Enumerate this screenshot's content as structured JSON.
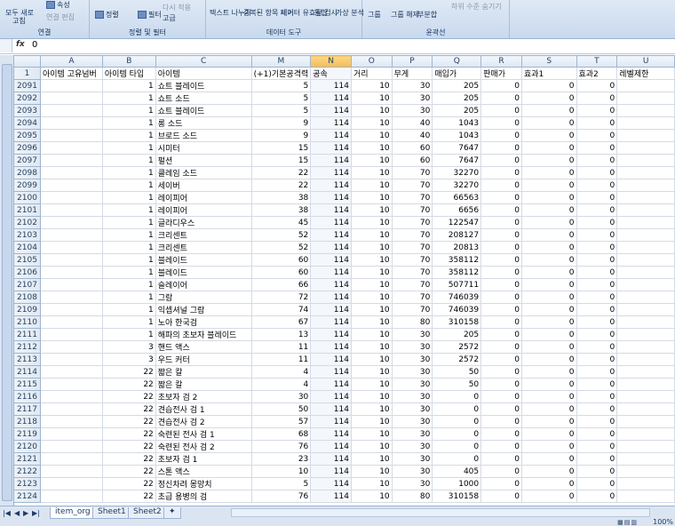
{
  "ribbon": {
    "groups": [
      {
        "title": "연결",
        "buttons": [
          "속성",
          "모두 새로",
          "고침",
          "연결 편집"
        ]
      },
      {
        "title": "정렬 및 필터",
        "buttons": [
          "정렬",
          "필터",
          "다시 적용",
          "고급"
        ]
      },
      {
        "title": "데이터 도구",
        "buttons": [
          "텍스트 나누기",
          "중복된 항목 제거",
          "데이터 유효성 검사",
          "통합",
          "가상 분석"
        ]
      },
      {
        "title": "윤곽선",
        "buttons": [
          "그룹",
          "그룹 해제",
          "부분합",
          "하위 수준 숨기기"
        ]
      }
    ]
  },
  "formula_bar": {
    "fx": "fx",
    "value": "0"
  },
  "columns": [
    {
      "id": "row",
      "label": ""
    },
    {
      "id": "A",
      "label": "A"
    },
    {
      "id": "B",
      "label": "B"
    },
    {
      "id": "C",
      "label": "C"
    },
    {
      "id": "M",
      "label": "M"
    },
    {
      "id": "N",
      "label": "N"
    },
    {
      "id": "O",
      "label": "O"
    },
    {
      "id": "P",
      "label": "P"
    },
    {
      "id": "Q",
      "label": "Q"
    },
    {
      "id": "R",
      "label": "R"
    },
    {
      "id": "S",
      "label": "S"
    },
    {
      "id": "T",
      "label": "T"
    },
    {
      "id": "U",
      "label": "U"
    }
  ],
  "header_row": [
    "1",
    "아이템 고유넘버",
    "아이템 타입",
    "아이템",
    "(+1)기본공격력",
    "공속",
    "거리",
    "무게",
    "매입가",
    "판매가",
    "효과1",
    "효과2",
    "레벨제한"
  ],
  "rows": [
    [
      "2091",
      "",
      "1",
      "쇼트 블레이드",
      "5",
      "114",
      "10",
      "30",
      "205",
      "0",
      "0",
      "0",
      ""
    ],
    [
      "2092",
      "",
      "1",
      "쇼트 소드",
      "5",
      "114",
      "10",
      "30",
      "205",
      "0",
      "0",
      "0",
      ""
    ],
    [
      "2093",
      "",
      "1",
      "쇼트 블레이드",
      "5",
      "114",
      "10",
      "30",
      "205",
      "0",
      "0",
      "0",
      ""
    ],
    [
      "2094",
      "",
      "1",
      "롱 소드",
      "9",
      "114",
      "10",
      "40",
      "1043",
      "0",
      "0",
      "0",
      ""
    ],
    [
      "2095",
      "",
      "1",
      "브로드 소드",
      "9",
      "114",
      "10",
      "40",
      "1043",
      "0",
      "0",
      "0",
      ""
    ],
    [
      "2096",
      "",
      "1",
      "시미터",
      "15",
      "114",
      "10",
      "60",
      "7647",
      "0",
      "0",
      "0",
      ""
    ],
    [
      "2097",
      "",
      "1",
      "펄션",
      "15",
      "114",
      "10",
      "60",
      "7647",
      "0",
      "0",
      "0",
      ""
    ],
    [
      "2098",
      "",
      "1",
      "클레임 소드",
      "22",
      "114",
      "10",
      "70",
      "32270",
      "0",
      "0",
      "0",
      ""
    ],
    [
      "2099",
      "",
      "1",
      "세이버",
      "22",
      "114",
      "10",
      "70",
      "32270",
      "0",
      "0",
      "0",
      ""
    ],
    [
      "2100",
      "",
      "1",
      "레이피어",
      "38",
      "114",
      "10",
      "70",
      "66563",
      "0",
      "0",
      "0",
      ""
    ],
    [
      "2101",
      "",
      "1",
      "레이피어",
      "38",
      "114",
      "10",
      "70",
      "6656",
      "0",
      "0",
      "0",
      ""
    ],
    [
      "2102",
      "",
      "1",
      "글라디우스",
      "45",
      "114",
      "10",
      "70",
      "122547",
      "0",
      "0",
      "0",
      ""
    ],
    [
      "2103",
      "",
      "1",
      "크리센트",
      "52",
      "114",
      "10",
      "70",
      "208127",
      "0",
      "0",
      "0",
      ""
    ],
    [
      "2104",
      "",
      "1",
      "크리센트",
      "52",
      "114",
      "10",
      "70",
      "20813",
      "0",
      "0",
      "0",
      ""
    ],
    [
      "2105",
      "",
      "1",
      "블레이드",
      "60",
      "114",
      "10",
      "70",
      "358112",
      "0",
      "0",
      "0",
      ""
    ],
    [
      "2106",
      "",
      "1",
      "블레이드",
      "60",
      "114",
      "10",
      "70",
      "358112",
      "0",
      "0",
      "0",
      ""
    ],
    [
      "2107",
      "",
      "1",
      "슬레이어",
      "66",
      "114",
      "10",
      "70",
      "507711",
      "0",
      "0",
      "0",
      ""
    ],
    [
      "2108",
      "",
      "1",
      "그람",
      "72",
      "114",
      "10",
      "70",
      "746039",
      "0",
      "0",
      "0",
      ""
    ],
    [
      "2109",
      "",
      "1",
      "익셉셔널 그람",
      "74",
      "114",
      "10",
      "70",
      "746039",
      "0",
      "0",
      "0",
      ""
    ],
    [
      "2110",
      "",
      "1",
      "노아 한국검",
      "67",
      "114",
      "10",
      "80",
      "310158",
      "0",
      "0",
      "0",
      ""
    ],
    [
      "2111",
      "",
      "1",
      "해파의 초보자 블레이드",
      "13",
      "114",
      "10",
      "30",
      "205",
      "0",
      "0",
      "0",
      ""
    ],
    [
      "2112",
      "",
      "3",
      "핸드 액스",
      "11",
      "114",
      "10",
      "30",
      "2572",
      "0",
      "0",
      "0",
      ""
    ],
    [
      "2113",
      "",
      "3",
      "우드 커터",
      "11",
      "114",
      "10",
      "30",
      "2572",
      "0",
      "0",
      "0",
      ""
    ],
    [
      "2114",
      "",
      "22",
      "짧은 칼",
      "4",
      "114",
      "10",
      "30",
      "50",
      "0",
      "0",
      "0",
      ""
    ],
    [
      "2115",
      "",
      "22",
      "짧은 칼",
      "4",
      "114",
      "10",
      "30",
      "50",
      "0",
      "0",
      "0",
      ""
    ],
    [
      "2116",
      "",
      "22",
      "초보자 검 2",
      "30",
      "114",
      "10",
      "30",
      "0",
      "0",
      "0",
      "0",
      ""
    ],
    [
      "2117",
      "",
      "22",
      "견습전사 검 1",
      "50",
      "114",
      "10",
      "30",
      "0",
      "0",
      "0",
      "0",
      ""
    ],
    [
      "2118",
      "",
      "22",
      "견습전사 검 2",
      "57",
      "114",
      "10",
      "30",
      "0",
      "0",
      "0",
      "0",
      ""
    ],
    [
      "2119",
      "",
      "22",
      "숙련된 전사 검 1",
      "68",
      "114",
      "10",
      "30",
      "0",
      "0",
      "0",
      "0",
      ""
    ],
    [
      "2120",
      "",
      "22",
      "숙련된 전사 검 2",
      "76",
      "114",
      "10",
      "30",
      "0",
      "0",
      "0",
      "0",
      ""
    ],
    [
      "2121",
      "",
      "22",
      "초보자 검 1",
      "23",
      "114",
      "10",
      "30",
      "0",
      "0",
      "0",
      "0",
      ""
    ],
    [
      "2122",
      "",
      "22",
      "스톤 액스",
      "10",
      "114",
      "10",
      "30",
      "405",
      "0",
      "0",
      "0",
      ""
    ],
    [
      "2123",
      "",
      "22",
      "정신차려 몽망치",
      "5",
      "114",
      "10",
      "30",
      "1000",
      "0",
      "0",
      "0",
      ""
    ],
    [
      "2124",
      "",
      "22",
      "초급 용병의 검",
      "76",
      "114",
      "10",
      "80",
      "310158",
      "0",
      "0",
      "0",
      ""
    ]
  ],
  "sheet_tabs": [
    "item_org",
    "Sheet1",
    "Sheet2"
  ],
  "status": {
    "zoom": "100%"
  }
}
